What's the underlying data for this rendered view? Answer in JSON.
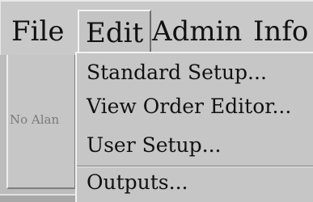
{
  "menubar": {
    "items": [
      {
        "label": "File"
      },
      {
        "label": "Edit"
      },
      {
        "label": "Admin"
      },
      {
        "label": "Info"
      }
    ]
  },
  "background": {
    "status_text": "No Alan"
  },
  "edit_menu": {
    "items": [
      {
        "label": "Standard Setup..."
      },
      {
        "label": "View Order Editor..."
      },
      {
        "label": "User Setup..."
      },
      {
        "label": "Outputs..."
      }
    ]
  }
}
